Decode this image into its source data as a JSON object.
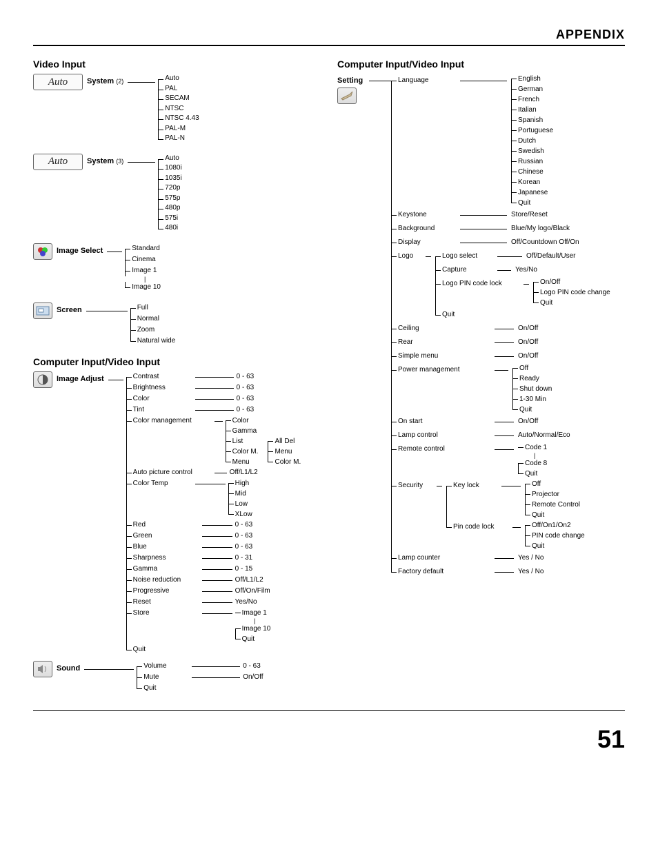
{
  "page": {
    "header": "APPENDIX",
    "number": "51"
  },
  "left": {
    "title1": "Video Input",
    "system2": {
      "label": "System",
      "sub": "(2)",
      "icon_text": "Auto",
      "items": [
        "Auto",
        "PAL",
        "SECAM",
        "NTSC",
        "NTSC 4.43",
        "PAL-M",
        "PAL-N"
      ]
    },
    "system3": {
      "label": "System",
      "sub": "(3)",
      "icon_text": "Auto",
      "items": [
        "Auto",
        "1080i",
        "1035i",
        "720p",
        "575p",
        "480p",
        "575i",
        "480i"
      ]
    },
    "image_select": {
      "label": "Image Select",
      "items_top": [
        "Standard",
        "Cinema",
        "Image 1"
      ],
      "dots": true,
      "items_bottom": [
        "Image 10"
      ]
    },
    "screen": {
      "label": "Screen",
      "items": [
        "Full",
        "Normal",
        "Zoom",
        "Natural wide"
      ]
    },
    "title2": "Computer Input/Video Input",
    "image_adjust": {
      "label": "Image Adjust",
      "simple_range063": [
        "Contrast",
        "Brightness",
        "Color",
        "Tint"
      ],
      "range_val": "0 - 63",
      "color_mgmt": {
        "label": "Color management",
        "items": [
          "Color",
          "Gamma",
          "List",
          "Color M.",
          "Menu"
        ],
        "list_sub": [
          "All Del",
          "Menu",
          "Color M."
        ]
      },
      "auto_pic": {
        "label": "Auto picture control",
        "val": "Off/L1/L2"
      },
      "color_temp": {
        "label": "Color Temp",
        "items": [
          "High",
          "Mid",
          "Low",
          "XLow"
        ]
      },
      "rgb": [
        {
          "l": "Red",
          "v": "0 - 63"
        },
        {
          "l": "Green",
          "v": "0 - 63"
        },
        {
          "l": "Blue",
          "v": "0 - 63"
        },
        {
          "l": "Sharpness",
          "v": "0 - 31"
        },
        {
          "l": "Gamma",
          "v": "0 - 15"
        },
        {
          "l": "Noise reduction",
          "v": "Off/L1/L2"
        },
        {
          "l": "Progressive",
          "v": "Off/On/Film"
        },
        {
          "l": "Reset",
          "v": "Yes/No"
        }
      ],
      "store": {
        "label": "Store",
        "items_top": [
          "Image 1"
        ],
        "items_bottom": [
          "Image 10",
          "Quit"
        ]
      },
      "quit": "Quit"
    },
    "sound": {
      "label": "Sound",
      "items": [
        {
          "l": "Volume",
          "v": "0 - 63"
        },
        {
          "l": "Mute",
          "v": "On/Off"
        },
        {
          "l": "Quit",
          "v": ""
        }
      ]
    }
  },
  "right": {
    "title": "Computer Input/Video Input",
    "setting_label": "Setting",
    "language": {
      "label": "Language",
      "items": [
        "English",
        "German",
        "French",
        "Italian",
        "Spanish",
        "Portuguese",
        "Dutch",
        "Swedish",
        "Russian",
        "Chinese",
        "Korean",
        "Japanese",
        "Quit"
      ]
    },
    "keystone": {
      "l": "Keystone",
      "v": "Store/Reset"
    },
    "background": {
      "l": "Background",
      "v": "Blue/My logo/Black"
    },
    "display": {
      "l": "Display",
      "v": "Off/Countdown Off/On"
    },
    "logo": {
      "l": "Logo",
      "logo_select": {
        "l": "Logo select",
        "v": "Off/Default/User"
      },
      "capture": {
        "l": "Capture",
        "v": "Yes/No"
      },
      "pin_lock": {
        "l": "Logo PIN code lock",
        "items": [
          "On/Off",
          "Logo PIN code change",
          "Quit"
        ]
      },
      "quit": "Quit"
    },
    "ceiling": {
      "l": "Ceiling",
      "v": "On/Off"
    },
    "rear": {
      "l": "Rear",
      "v": "On/Off"
    },
    "simple": {
      "l": "Simple menu",
      "v": "On/Off"
    },
    "power_mgmt": {
      "l": "Power management",
      "items": [
        "Off",
        "Ready",
        "Shut down",
        "1-30 Min",
        "Quit"
      ]
    },
    "on_start": {
      "l": "On start",
      "v": "On/Off"
    },
    "lamp_ctrl": {
      "l": "Lamp control",
      "v": "Auto/Normal/Eco"
    },
    "remote": {
      "l": "Remote control",
      "items_top": [
        "Code 1"
      ],
      "dots": true,
      "items_bottom": [
        "Code 8",
        "Quit"
      ]
    },
    "security": {
      "l": "Security",
      "key_lock": {
        "l": "Key lock",
        "items": [
          "Off",
          "Projector",
          "Remote Control",
          "Quit"
        ]
      },
      "pin_lock": {
        "l": "Pin code lock",
        "items": [
          "Off/On1/On2",
          "PIN code change",
          "Quit"
        ]
      }
    },
    "lamp_counter": {
      "l": "Lamp counter",
      "v": "Yes / No"
    },
    "factory": {
      "l": "Factory default",
      "v": "Yes / No"
    }
  }
}
